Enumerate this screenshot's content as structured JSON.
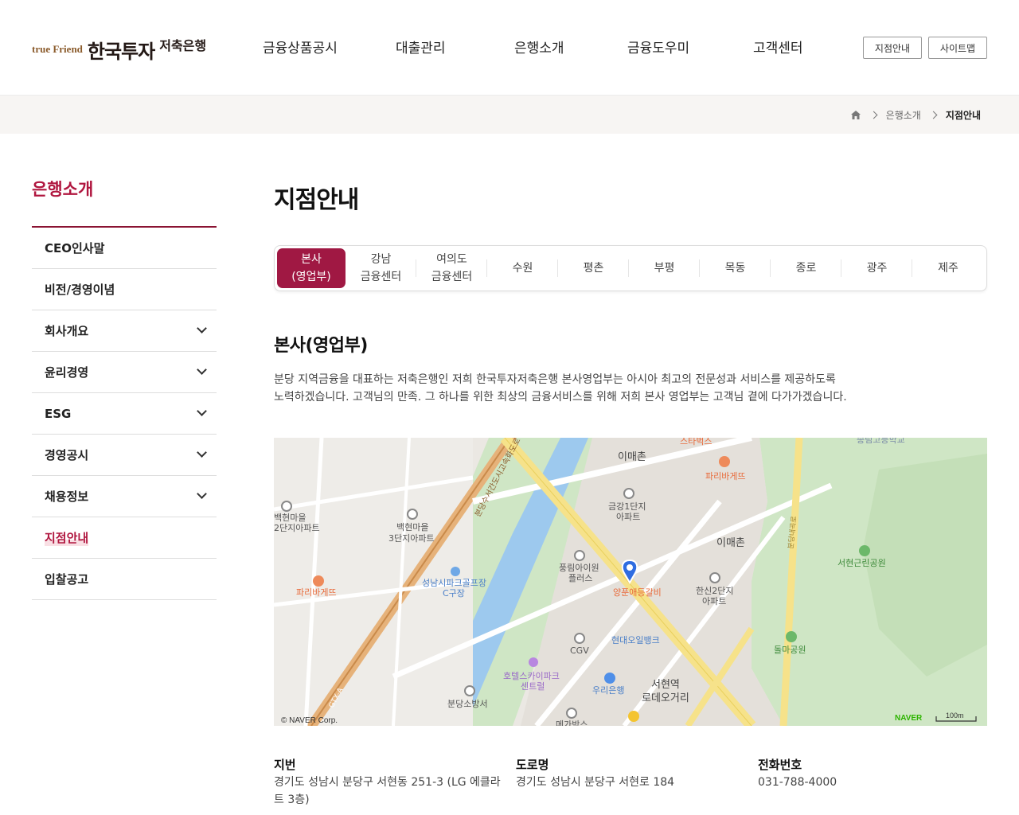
{
  "brand": {
    "logo_en": "true Friend",
    "logo_kr": "한국투자",
    "logo_sub": "저축은행"
  },
  "gnb": [
    "금융상품공시",
    "대출관리",
    "은행소개",
    "금융도우미",
    "고객센터"
  ],
  "util": {
    "branch_btn": "지점안내",
    "sitemap_btn": "사이트맵"
  },
  "breadcrumb": {
    "home_icon": "home-icon",
    "level1": "은행소개",
    "current": "지점안내"
  },
  "sidebar": {
    "title": "은행소개",
    "items": [
      {
        "label": "CEO인사말",
        "expandable": false
      },
      {
        "label": "비전/경영이념",
        "expandable": false
      },
      {
        "label": "회사개요",
        "expandable": true
      },
      {
        "label": "윤리경영",
        "expandable": true
      },
      {
        "label": "ESG",
        "expandable": true
      },
      {
        "label": "경영공시",
        "expandable": true
      },
      {
        "label": "채용정보",
        "expandable": true
      },
      {
        "label": "지점안내",
        "expandable": false,
        "active": true
      },
      {
        "label": "입찰공고",
        "expandable": false
      }
    ]
  },
  "page_title": "지점안내",
  "tabs": [
    {
      "line1": "본사",
      "line2": "(영업부)",
      "active": true
    },
    {
      "line1": "강남",
      "line2": "금융센터"
    },
    {
      "line1": "여의도",
      "line2": "금융센터"
    },
    {
      "line1": "수원",
      "line2": ""
    },
    {
      "line1": "평촌",
      "line2": ""
    },
    {
      "line1": "부평",
      "line2": ""
    },
    {
      "line1": "목동",
      "line2": ""
    },
    {
      "line1": "종로",
      "line2": ""
    },
    {
      "line1": "광주",
      "line2": ""
    },
    {
      "line1": "제주",
      "line2": ""
    }
  ],
  "branch": {
    "title": "본사(영업부)",
    "desc_line1": "분당 지역금융을 대표하는 저축은행인 저희 한국투자저축은행 본사영업부는 아시아 최고의 전문성과 서비스를 제공하도록",
    "desc_line2": "노력하겠습니다. 고객님의 만족. 그 하나를 위한 최상의 금융서비스를 위해 저희 본사 영업부는 고객님 곁에 다가가겠습니다."
  },
  "map": {
    "labels": {
      "starbucks": "스타벅스",
      "school": "송림고등학교",
      "imae1": "이매촌",
      "paris1": "파리바게뜨",
      "geumgang": "금강1단지",
      "geumgang2": "아파트",
      "imae2": "이매촌",
      "seohyeon_park": "서현근린공원",
      "baekhyeon": "백현마을",
      "baekhyeon2": "3단지아파트",
      "left_apt1": "백현마을",
      "left_apt2": "2단지아파트",
      "pungrim": "풍림아이원",
      "pungrim2": "플러스",
      "restaurant": "양푼애등갈비",
      "hanshin": "한신2단지",
      "hanshin2": "아파트",
      "golf": "성남시파크골프장",
      "golf2": "C구장",
      "paris2": "파리바게뜨",
      "hyundai": "현대오일뱅크",
      "dolma": "돌마공원",
      "cgv": "CGV",
      "hotel": "호텔스카이파크",
      "hotel2": "센트럴",
      "woori": "우리은행",
      "station": "서현역",
      "station2": "로데오거리",
      "fire": "분당소방서",
      "megabox": "메가박스",
      "bundang_road": "분당수서간도시고속화도로",
      "gtx": "GTX-A",
      "hwy": "분당내곡로",
      "copyright": "© NAVER Corp.",
      "naver": "NAVER",
      "scale": "100m"
    }
  },
  "info": {
    "jibun_label": "지번",
    "jibun_value": "경기도 성남시 분당구 서현동 251-3 (LG 에클라트 3층)",
    "road_label": "도로명",
    "road_value": "경기도 성남시 분당구 서현로 184",
    "phone_label": "전화번호",
    "phone_value": "031-788-4000"
  },
  "colors": {
    "accent": "#a01843",
    "accent_text": "#b0163f",
    "band": "#f7f5f3"
  }
}
